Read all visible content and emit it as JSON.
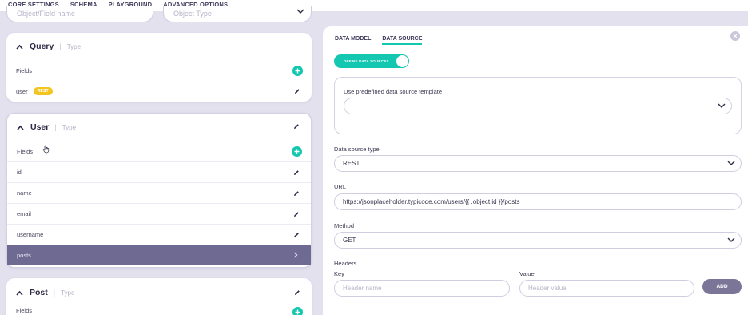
{
  "top_tabs": [
    {
      "label": "CORE SETTINGS",
      "active": false
    },
    {
      "label": "SCHEMA",
      "active": true
    },
    {
      "label": "PLAYGROUND",
      "active": false
    },
    {
      "label": "ADVANCED OPTIONS",
      "active": false
    }
  ],
  "filters": {
    "object_field_placeholder": "Object/Field name",
    "object_type_placeholder": "Object Type"
  },
  "types": {
    "query": {
      "name": "Query",
      "kind": "Type",
      "fields_label": "Fields",
      "fields": [
        {
          "name": "user",
          "badge": "REST"
        }
      ]
    },
    "user": {
      "name": "User",
      "kind": "Type",
      "fields_label": "Fields",
      "fields": [
        "id",
        "name",
        "email",
        "username",
        "posts"
      ],
      "selected": "posts"
    },
    "post": {
      "name": "Post",
      "kind": "Type",
      "fields_label": "Fields"
    }
  },
  "panel": {
    "tabs": [
      {
        "label": "DATA MODEL",
        "active": false
      },
      {
        "label": "DATA SOURCE",
        "active": true
      }
    ],
    "toggle_label": "DEFINE DATA SOURCES",
    "toggle_on": true,
    "template_label": "Use predefined data source template",
    "template_value": "",
    "source_type_label": "Data source type",
    "source_type_value": "REST",
    "url_label": "URL",
    "url_value": "https://jsonplaceholder.typicode.com/users/{{ .object.id }}/posts",
    "method_label": "Method",
    "method_value": "GET",
    "headers_label": "Headers",
    "key_label": "Key",
    "value_label": "Value",
    "key_placeholder": "Header name",
    "value_placeholder": "Header value",
    "add_label": "ADD"
  },
  "colors": {
    "accent": "#13c7b0",
    "badge": "#f3c520",
    "selected_row": "#6f6a92",
    "background": "#e3e1ee"
  }
}
